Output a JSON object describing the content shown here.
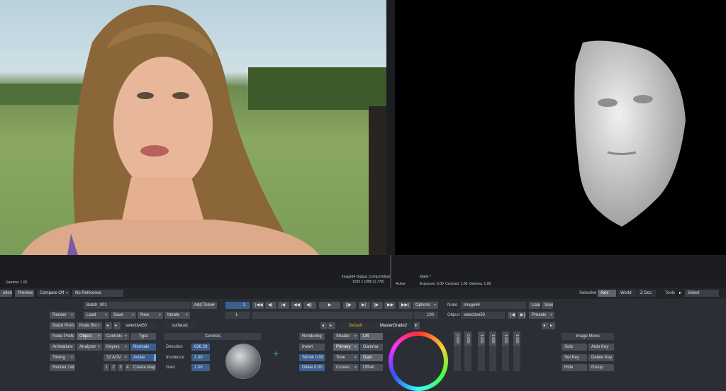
{
  "left_view": {
    "gamma": "Gamma: 1.00",
    "info_line1": "image64 Output_Comp Default",
    "info_line2": "1920 x 1080 (1.778)"
  },
  "right_view": {
    "matte": "Matte *",
    "active": "Active",
    "exposure": "Exposure: 0.00",
    "contrast": "Contrast: 1.00",
    "gamma": "Gamma: 1.00"
  },
  "toolbar": {
    "ution": "ution",
    "preview": "Preview",
    "compare": "Compare Off",
    "reference": "No Reference",
    "selective": "Selective",
    "axis": "Axis",
    "world": "World",
    "zocc": "Z Occ",
    "tools": "Tools",
    "select": "Select"
  },
  "batch": {
    "name": "Batch_001",
    "add_token": "Add Token"
  },
  "row2": {
    "render": "Render",
    "load": "Load",
    "save": "Save",
    "new": "New",
    "iterate": "Iterate"
  },
  "row3": {
    "batch_prefs": "Batch Prefs",
    "node_bin": "Node Bin",
    "selective50": "selective50",
    "surface1": "surface1"
  },
  "transport": {
    "frame": "1",
    "start": "1",
    "end": "100",
    "options": "Options"
  },
  "node_panel": {
    "node_label": "Node",
    "node_value": "image64",
    "load": "Load",
    "save": "Save",
    "object_label": "Object",
    "object_value": "selective50",
    "presets": "Presets"
  },
  "grade": {
    "default": "Default",
    "mastergrade": "MasterGrade2"
  },
  "left_col": {
    "node_prefs": "Node Prefs",
    "animation": "Animation",
    "timing": "Timing",
    "render_list": "Render List"
  },
  "obj_col": {
    "object": "Object",
    "analyzer": "Analyzer",
    "aov": "32 AOV",
    "pages": [
      "1",
      "2",
      "3",
      "4"
    ]
  },
  "ctrl_col": {
    "controls": "Controls",
    "keyers": "Keyers",
    "type": "Type",
    "normals": "Normals",
    "active": "Active",
    "create_map": "Create Map"
  },
  "controls": {
    "header": "Controls",
    "direction": "Direction",
    "direction_val": "636.28",
    "incidence": "Incidence",
    "incidence_val": "1.00",
    "gain": "Gain",
    "gain_val": "1.00"
  },
  "render_col": {
    "rendering": "Rendering",
    "invert": "Invert",
    "shrink": "Shrink 0.00",
    "dilate": "Dilate 0.00"
  },
  "shader_col": {
    "shader": "Shader",
    "lift": "Lift",
    "primary": "Primary",
    "gamma": "Gamma",
    "tone": "Tone",
    "gain": "Gain",
    "curves": "Curves",
    "offset": "Offset"
  },
  "sliders": [
    "0.000",
    "0.000",
    "1.000",
    "1.000",
    "1.000",
    "1.000"
  ],
  "image_menu": {
    "header": "Image Menu",
    "solo": "Solo",
    "auto_key": "Auto Key",
    "set_key": "Set Key",
    "delete_key": "Delete Key",
    "hide": "Hide",
    "group": "Group"
  },
  "colors": {
    "accent": "#7aa7e6",
    "button": "#4a4f58",
    "panel": "#2b2e34",
    "highlight": "#e0b020"
  }
}
